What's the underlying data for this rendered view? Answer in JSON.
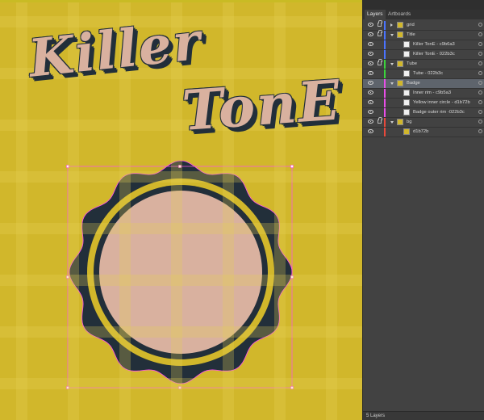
{
  "artboard": {
    "title_word1": "Killer",
    "title_word2": "TonE",
    "background_color": "#d1b72b",
    "title_color": "#d9b19f",
    "outline_color": "#222f3a",
    "grid_color": "#d9c23f",
    "selection_color": "#ff4df0"
  },
  "panel": {
    "tabs": [
      {
        "label": "Layers",
        "active": true
      },
      {
        "label": "Artboards",
        "active": false
      }
    ],
    "layers": [
      {
        "name": "grid",
        "depth": 0,
        "expanded": false,
        "locked": true,
        "color": "#4a73ff",
        "selected": false
      },
      {
        "name": "Title",
        "depth": 0,
        "expanded": true,
        "locked": true,
        "color": "#4a73ff",
        "selected": false
      },
      {
        "name": "Killer   TonE - c9b6a3",
        "depth": 1,
        "expanded": false,
        "locked": false,
        "color": "#4a73ff",
        "selected": false
      },
      {
        "name": "Killer   TonE - 022b3c",
        "depth": 1,
        "expanded": false,
        "locked": false,
        "color": "#4a73ff",
        "selected": false
      },
      {
        "name": "Tube",
        "depth": 0,
        "expanded": true,
        "locked": true,
        "color": "#3bd43b",
        "selected": false
      },
      {
        "name": "Tube - 022b3c",
        "depth": 1,
        "expanded": false,
        "locked": false,
        "color": "#3bd43b",
        "selected": false
      },
      {
        "name": "Badge",
        "depth": 0,
        "expanded": true,
        "locked": false,
        "color": "#e84ee8",
        "selected": true
      },
      {
        "name": "Inner rim - c9b5a3",
        "depth": 1,
        "expanded": false,
        "locked": false,
        "color": "#e84ee8",
        "selected": false
      },
      {
        "name": "Yellow inner circle - d1b72b",
        "depth": 1,
        "expanded": false,
        "locked": false,
        "color": "#e84ee8",
        "selected": false
      },
      {
        "name": "Badge outer rim -022b3c",
        "depth": 1,
        "expanded": false,
        "locked": false,
        "color": "#e84ee8",
        "selected": false
      },
      {
        "name": "bg",
        "depth": 0,
        "expanded": true,
        "locked": true,
        "color": "#e8493b",
        "selected": false
      },
      {
        "name": "d1b72b",
        "depth": 1,
        "expanded": false,
        "locked": false,
        "color": "#e8493b",
        "selected": false
      }
    ],
    "footer": "5 Layers"
  }
}
